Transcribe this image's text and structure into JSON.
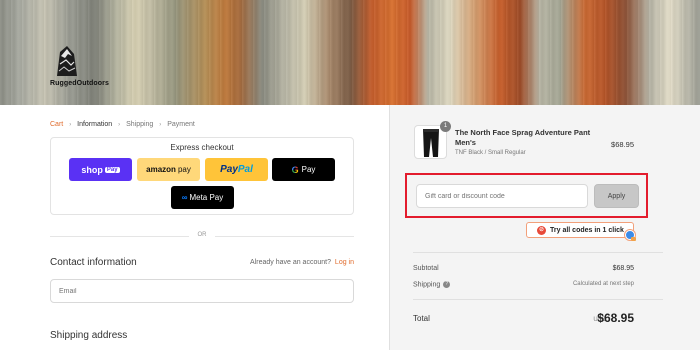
{
  "brand": {
    "name": "RuggedOutdoors"
  },
  "breadcrumb": {
    "items": [
      "Cart",
      "Information",
      "Shipping",
      "Payment"
    ],
    "current": "Information"
  },
  "express_checkout": {
    "title": "Express checkout",
    "buttons": {
      "shop_pay": {
        "label": "shop",
        "chip": "Pay"
      },
      "amazon_pay": {
        "label": "amazon",
        "suffix": "pay"
      },
      "paypal": {
        "label_pay": "Pay",
        "label_pal": "Pal"
      },
      "google_pay": {
        "logo": "G",
        "label": "Pay"
      },
      "meta_pay": {
        "icon": "∞",
        "label": "Meta Pay"
      }
    }
  },
  "divider": {
    "label": "OR"
  },
  "contact": {
    "title": "Contact information",
    "account_prompt": "Already have an account?",
    "login_label": "Log in",
    "email_placeholder": "Email"
  },
  "shipping_address": {
    "title": "Shipping address"
  },
  "order": {
    "item": {
      "name": "The North Face Sprag Adventure Pant Men's",
      "variant": "TNF Black / Small Regular",
      "price": "$68.95",
      "quantity": "1"
    },
    "discount": {
      "placeholder": "Gift card or discount code",
      "apply_label": "Apply"
    },
    "try_codes_label": "Try all codes in 1 click",
    "subtotal_label": "Subtotal",
    "subtotal_value": "$68.95",
    "shipping_label": "Shipping",
    "shipping_value": "Calculated at next step",
    "total_label": "Total",
    "total_currency": "USD",
    "total_value": "$68.95"
  },
  "colors": {
    "accent": "#e06b2c",
    "highlight_border": "#e31c2d",
    "shop_pay": "#5a31f4",
    "amazon_pay": "#ffd87a",
    "paypal": "#ffc439"
  }
}
